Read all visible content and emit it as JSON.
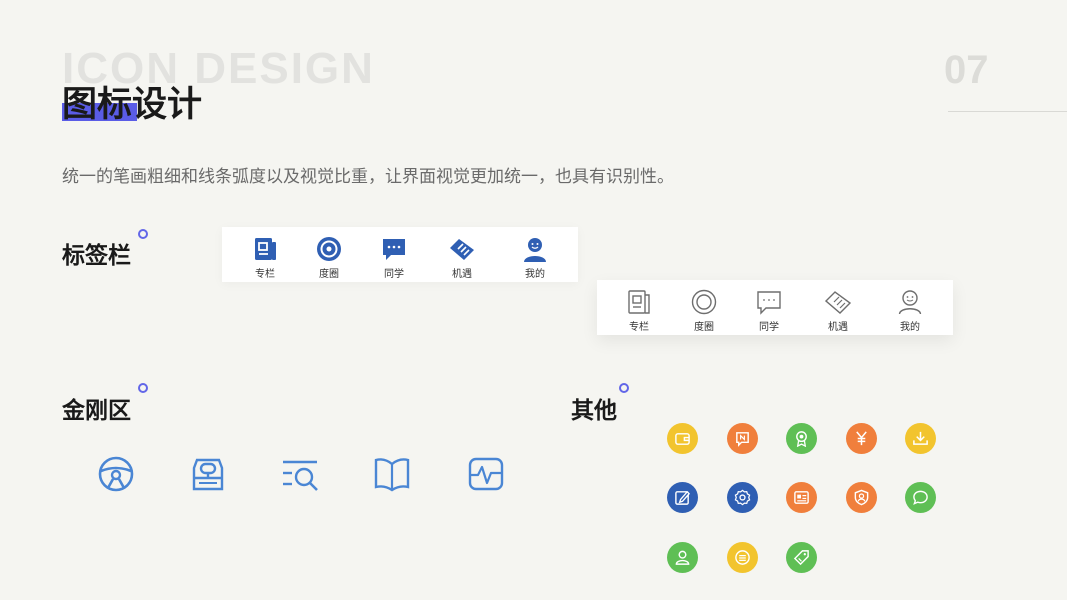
{
  "header": {
    "bg_title": "ICON DESIGN",
    "title": "图标设计",
    "page_number": "07",
    "subtitle": "统一的笔画粗细和线条弧度以及视觉比重，让界面视觉更加统一，也具有识别性。"
  },
  "sections": {
    "tabbar": "标签栏",
    "kingkong": "金刚区",
    "other": "其他"
  },
  "tabbar_blue": {
    "items": [
      {
        "label": "专栏",
        "icon": "column-icon"
      },
      {
        "label": "度圈",
        "icon": "circle-icon"
      },
      {
        "label": "同学",
        "icon": "chat-icon"
      },
      {
        "label": "机遇",
        "icon": "handshake-icon"
      },
      {
        "label": "我的",
        "icon": "user-icon"
      }
    ]
  },
  "tabbar_grey": {
    "items": [
      {
        "label": "专栏",
        "icon": "column-icon"
      },
      {
        "label": "度圈",
        "icon": "circle-icon"
      },
      {
        "label": "同学",
        "icon": "chat-icon"
      },
      {
        "label": "机遇",
        "icon": "handshake-icon"
      },
      {
        "label": "我的",
        "icon": "user-icon"
      }
    ]
  },
  "kingkong_icons": [
    "steering-wheel-icon",
    "inbox-icon",
    "search-list-icon",
    "book-icon",
    "pulse-monitor-icon"
  ],
  "other_icons": [
    {
      "icon": "wallet-icon",
      "color": "#f2c42e"
    },
    {
      "icon": "notice-icon",
      "color": "#f07f3c"
    },
    {
      "icon": "badge-icon",
      "color": "#5fbf55"
    },
    {
      "icon": "yuan-icon",
      "color": "#f07f3c"
    },
    {
      "icon": "download-icon",
      "color": "#f2c42e"
    },
    {
      "icon": "edit-icon",
      "color": "#2f5fb3"
    },
    {
      "icon": "settings-icon",
      "color": "#2f5fb3"
    },
    {
      "icon": "id-card-icon",
      "color": "#f07f3c"
    },
    {
      "icon": "shield-user-icon",
      "color": "#f07f3c"
    },
    {
      "icon": "message-icon",
      "color": "#5fbf55"
    },
    {
      "icon": "person-icon",
      "color": "#5fbf55"
    },
    {
      "icon": "coin-icon",
      "color": "#f2c42e"
    },
    {
      "icon": "tag-icon",
      "color": "#5fbf55"
    }
  ],
  "colors": {
    "accent": "#5a5ce6",
    "tab_blue": "#2f5fb3",
    "tab_grey": "#6e6e6e",
    "line_blue": "#4a86d4"
  }
}
